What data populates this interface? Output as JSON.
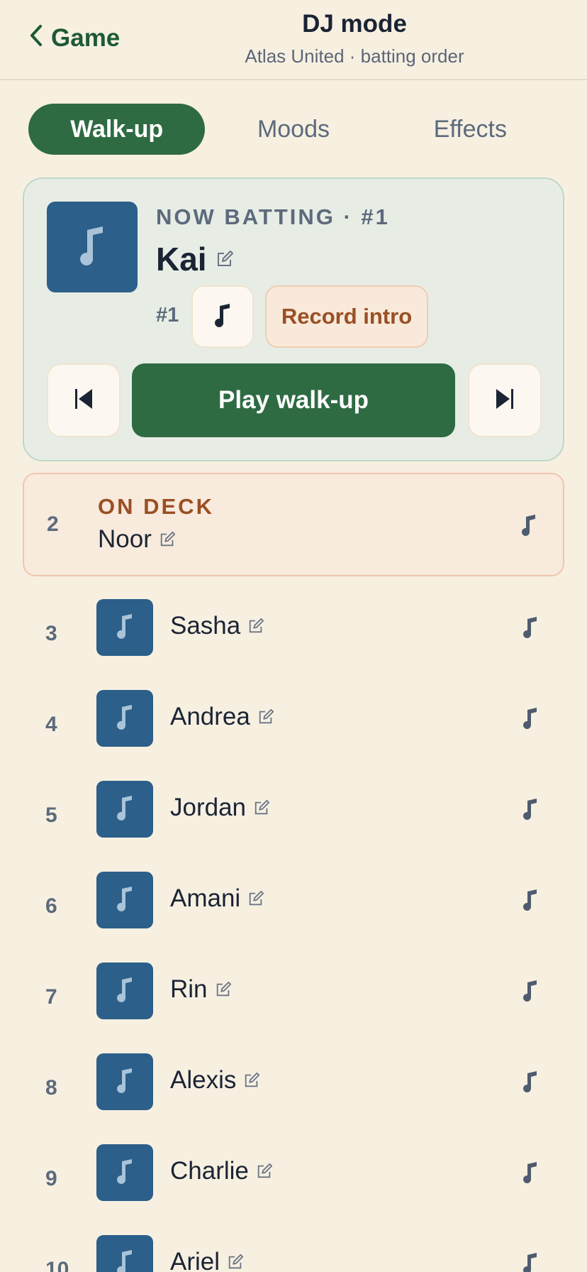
{
  "header": {
    "back_label": "Game",
    "title": "DJ mode",
    "subtitle": "Atlas United · batting order"
  },
  "tabs": [
    {
      "label": "Walk-up",
      "active": true
    },
    {
      "label": "Moods",
      "active": false
    },
    {
      "label": "Effects",
      "active": false
    }
  ],
  "now_batting": {
    "label": "NOW BATTING · #1",
    "name": "Kai",
    "number": "#1",
    "record_label": "Record intro",
    "play_label": "Play walk-up"
  },
  "on_deck": {
    "order": "2",
    "label": "ON DECK",
    "name": "Noor"
  },
  "lineup": [
    {
      "order": "3",
      "name": "Sasha"
    },
    {
      "order": "4",
      "name": "Andrea"
    },
    {
      "order": "5",
      "name": "Jordan"
    },
    {
      "order": "6",
      "name": "Amani"
    },
    {
      "order": "7",
      "name": "Rin"
    },
    {
      "order": "8",
      "name": "Alexis"
    },
    {
      "order": "9",
      "name": "Charlie"
    },
    {
      "order": "10",
      "name": "Ariel"
    }
  ],
  "colors": {
    "background": "#f7f0e1",
    "accent_green": "#2e6b43",
    "art_blue": "#2c5f8a",
    "deck_orange": "#9a4f24"
  },
  "icons": {
    "back": "chevron-left-icon",
    "music": "music-note-icon",
    "edit": "edit-icon",
    "prev": "skip-previous-icon",
    "next": "skip-next-icon"
  }
}
